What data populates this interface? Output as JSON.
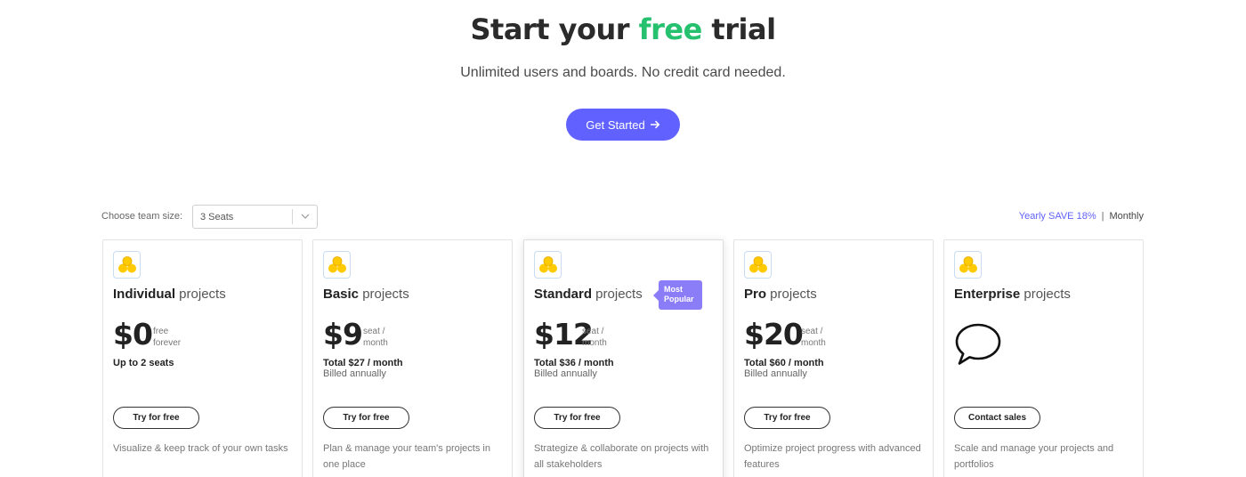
{
  "hero": {
    "title_pre": "Start your ",
    "title_accent": "free",
    "title_post": " trial",
    "subtitle": "Unlimited users and boards. No credit card needed.",
    "cta_label": "Get Started",
    "cta_icon": "arrow-right-icon"
  },
  "team_size": {
    "label": "Choose team size:",
    "value": "3 Seats",
    "icon": "chevron-down-icon"
  },
  "billing": {
    "yearly": "Yearly SAVE 18%",
    "divider": "|",
    "monthly": "Monthly"
  },
  "colors": {
    "accent_green": "#25c16f",
    "primary": "#6161ff",
    "badge": "#8b7cf8",
    "logo_yellow": "#ffcb00"
  },
  "plans": [
    {
      "name": "Individual",
      "suffix": " projects",
      "price": "$0",
      "unit_line1": "free",
      "unit_line2": "forever",
      "total": "Up to 2 seats",
      "billed": "",
      "button": "Try for free",
      "description": "Visualize & keep track of your own tasks"
    },
    {
      "name": "Basic",
      "suffix": " projects",
      "price": "$9",
      "unit_line1": "seat /",
      "unit_line2": "month",
      "total": "Total $27 / month",
      "billed": "Billed annually",
      "button": "Try for free",
      "description": "Plan & manage your team's projects in one place"
    },
    {
      "name": "Standard",
      "suffix": " projects",
      "badge": "Most Popular",
      "price": "$12",
      "unit_line1": "seat /",
      "unit_line2": "month",
      "total": "Total $36 / month",
      "billed": "Billed annually",
      "button": "Try for free",
      "description": "Strategize & collaborate on projects with all stakeholders"
    },
    {
      "name": "Pro",
      "suffix": " projects",
      "price": "$20",
      "unit_line1": "seat /",
      "unit_line2": "month",
      "total": "Total $60 / month",
      "billed": "Billed annually",
      "button": "Try for free",
      "description": "Optimize project progress with advanced features"
    },
    {
      "name": "Enterprise",
      "suffix": " projects",
      "icon": "chat-bubble-icon",
      "button": "Contact sales",
      "description": "Scale and manage your projects and portfolios"
    }
  ]
}
